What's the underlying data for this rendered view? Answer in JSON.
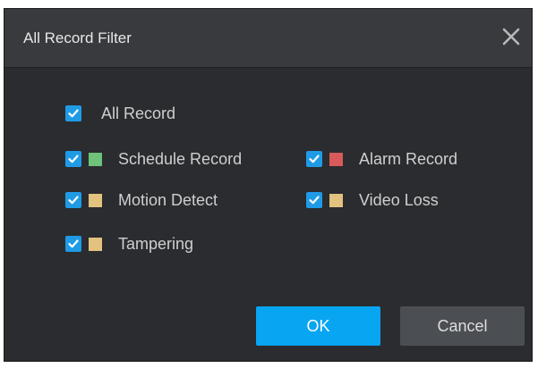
{
  "dialog": {
    "title": "All Record Filter",
    "close_icon": "close-icon"
  },
  "filters": {
    "all": {
      "label": "All Record",
      "checked": true
    },
    "items": [
      {
        "label": "Schedule Record",
        "checked": true,
        "color": "#6ec27a"
      },
      {
        "label": "Alarm Record",
        "checked": true,
        "color": "#d85a5a"
      },
      {
        "label": "Motion Detect",
        "checked": true,
        "color": "#e3c27f"
      },
      {
        "label": "Video Loss",
        "checked": true,
        "color": "#e3c27f"
      },
      {
        "label": "Tampering",
        "checked": true,
        "color": "#e3c27f"
      }
    ]
  },
  "buttons": {
    "ok_label": "OK",
    "cancel_label": "Cancel"
  },
  "colors": {
    "accent": "#08a5f2",
    "checkbox": "#1f9be6",
    "background": "#2a2c2f",
    "titlebar": "#383a3e"
  }
}
